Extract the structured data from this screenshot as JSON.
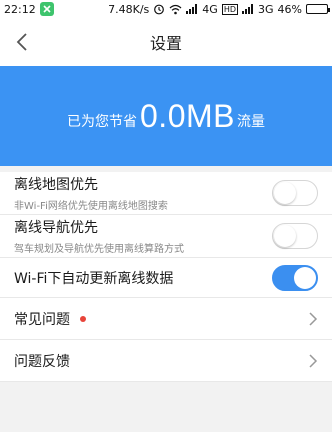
{
  "status_bar": {
    "time": "22:12",
    "net_speed": "7.48K/s",
    "network_4g": "4G",
    "network_hd": "HD",
    "network_3g": "3G",
    "battery_percent": "46%",
    "battery_level": 0.46
  },
  "header": {
    "title": "设置"
  },
  "banner": {
    "prefix": "已为您节省",
    "amount": "0.0MB",
    "suffix": "流量",
    "background_color": "#3b93f3"
  },
  "settings": {
    "offline_map": {
      "label": "离线地图优先",
      "description": "非Wi-Fi网络优先使用离线地图搜索",
      "enabled": false
    },
    "offline_nav": {
      "label": "离线导航优先",
      "description": "驾车规划及导航优先使用离线算路方式",
      "enabled": false
    },
    "wifi_auto_update": {
      "label": "Wi-Fi下自动更新离线数据",
      "enabled": true
    },
    "faq": {
      "label": "常见问题",
      "has_badge": true
    },
    "feedback": {
      "label": "问题反馈"
    }
  },
  "colors": {
    "accent": "#3b8ff0",
    "badge": "#e8443a"
  }
}
